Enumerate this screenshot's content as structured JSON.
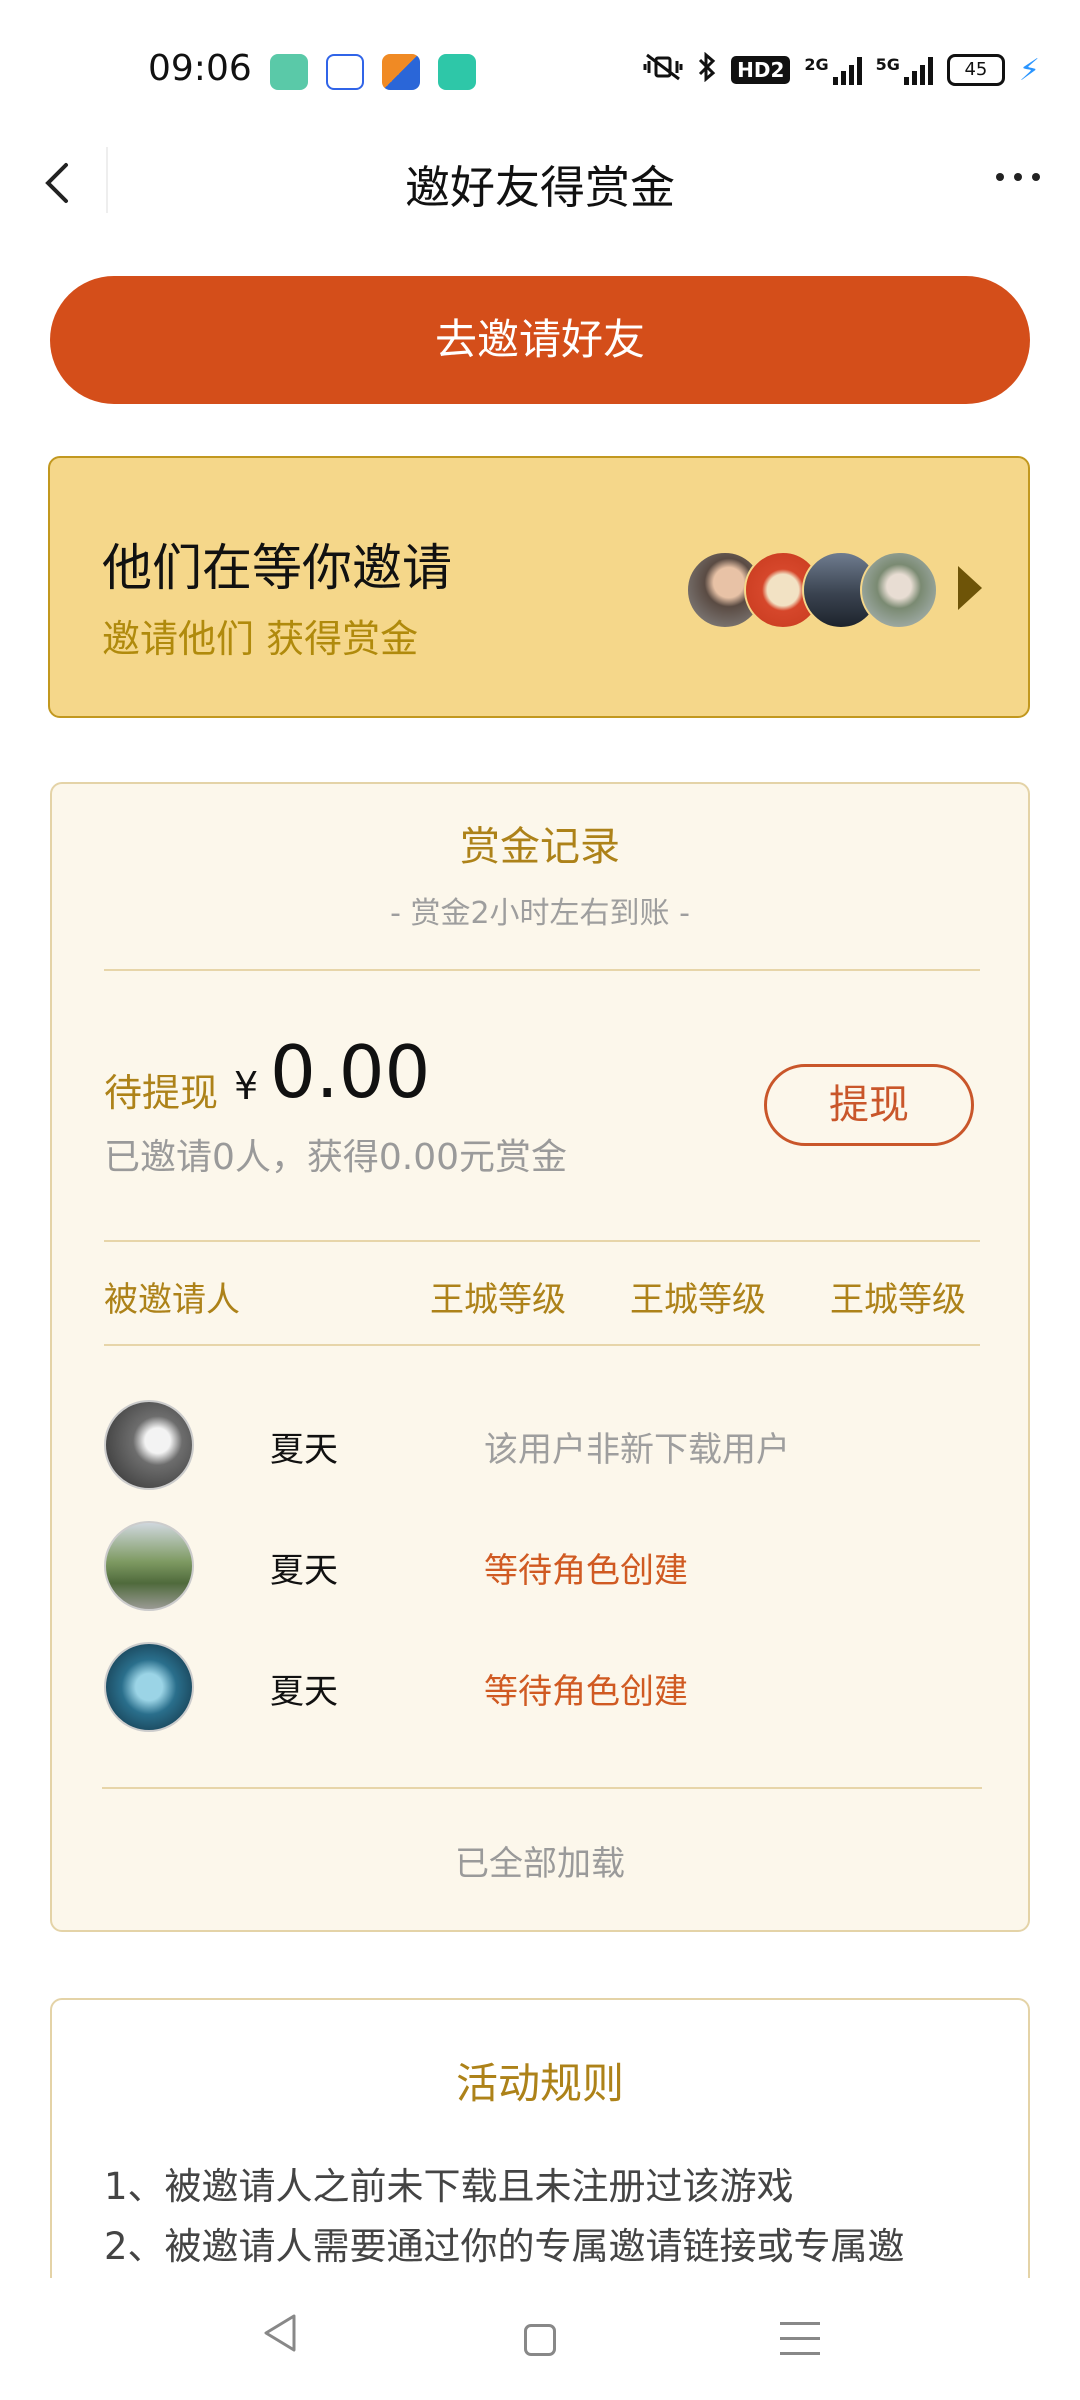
{
  "status_bar": {
    "time": "09:06",
    "battery": "45",
    "network_1": "2G",
    "network_2": "5G",
    "hd_label": "HD2"
  },
  "header": {
    "title": "邀好友得赏金"
  },
  "invite_button": {
    "label": "去邀请好友"
  },
  "waiting_card": {
    "title": "他们在等你邀请",
    "subtitle": "邀请他们 获得赏金"
  },
  "record": {
    "title": "赏金记录",
    "subtitle": "- 赏金2小时左右到账 -",
    "pending_label": "待提现",
    "currency": "¥",
    "amount": "0.00",
    "invited_summary": "已邀请0人，获得0.00元赏金",
    "withdraw_label": "提现",
    "columns": [
      "被邀请人",
      "王城等级",
      "王城等级",
      "王城等级"
    ],
    "rows": [
      {
        "name": "夏天",
        "status": "该用户非新下载用户",
        "status_color": "#9e9e9e"
      },
      {
        "name": "夏天",
        "status": "等待角色创建",
        "status_color": "#d05a22"
      },
      {
        "name": "夏天",
        "status": "等待角色创建",
        "status_color": "#d05a22"
      }
    ],
    "footer": "已全部加载"
  },
  "rules": {
    "title": "活动规则",
    "items": [
      "1、被邀请人之前未下载且未注册过该游戏",
      "2、被邀请人需要通过你的专属邀请链接或专属邀"
    ]
  },
  "colors": {
    "primary": "#d44e1a",
    "gold": "#ad8219",
    "card_yellow": "#f5d78a",
    "card_cream": "#fcf7eb"
  }
}
